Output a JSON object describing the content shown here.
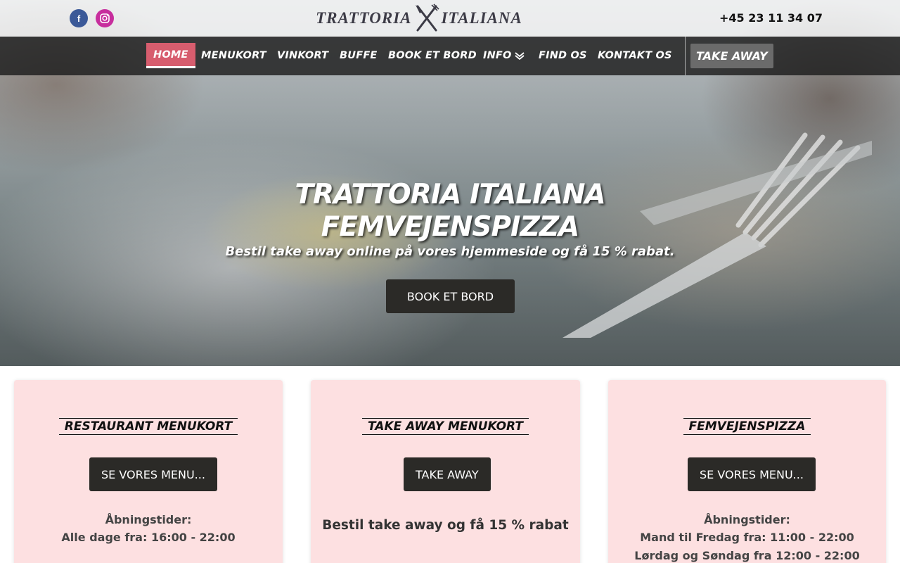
{
  "header": {
    "logo_left": "TRATTORIA",
    "logo_right": "ITALIANA",
    "phone": "+45 23 11 34 07",
    "social": [
      {
        "name": "facebook-icon",
        "glyph": "f",
        "color": "#3b5998"
      },
      {
        "name": "instagram-icon",
        "glyph": "◎",
        "color": "#c72e9d"
      }
    ]
  },
  "nav": {
    "items": [
      {
        "label": "HOME",
        "active": true
      },
      {
        "label": "MENUKORT"
      },
      {
        "label": "VINKORT"
      },
      {
        "label": "BUFFE"
      },
      {
        "label": "BOOK ET BORD"
      },
      {
        "label": "INFO"
      },
      {
        "label": "FIND OS"
      },
      {
        "label": "KONTAKT OS"
      }
    ],
    "takeaway": "TAKE AWAY",
    "accent": "#d75d6e"
  },
  "hero": {
    "title_line1": "TRATTORIA ITALIANA",
    "title_line2": "FEMVEJENSPIZZA",
    "subtitle": "Bestil take away online på vores hjemmeside og få 15 % rabat.",
    "button": "BOOK ET BORD"
  },
  "cards": [
    {
      "title": "RESTAURANT MENUKORT",
      "button": "SE VORES MENU...",
      "hours_label": "Åbningstider:",
      "hours": [
        "Alle dage fra: 16:00 - 22:00"
      ]
    },
    {
      "title": "TAKE AWAY MENUKORT",
      "button": "TAKE AWAY",
      "text": "Bestil take away og få 15 % rabat"
    },
    {
      "title": "FEMVEJENSPIZZA",
      "button": "SE VORES MENU...",
      "hours_label": "Åbningstider:",
      "hours": [
        "Mand til Fredag fra: 11:00 - 22:00",
        "Lørdag og Søndag fra 12:00 - 22:00"
      ]
    }
  ],
  "colors": {
    "card_bg": "#fde0e1",
    "button_bg": "#2b2a27"
  }
}
